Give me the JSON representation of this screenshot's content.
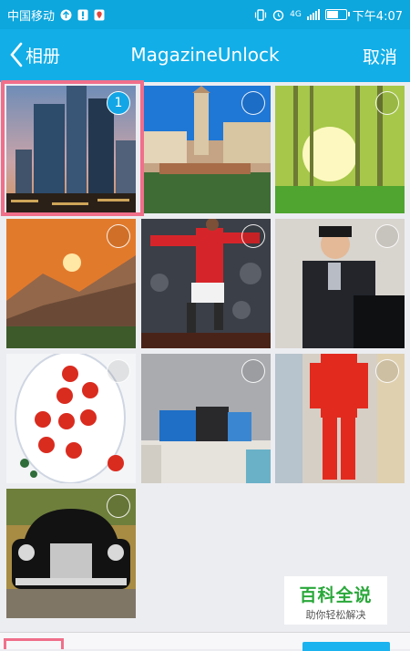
{
  "status_bar": {
    "carrier": "中国移动",
    "network": "4G",
    "time": "下午4:07"
  },
  "title_bar": {
    "back_label": "相册",
    "title": "MagazineUnlock",
    "cancel_label": "取消"
  },
  "photos": [
    {
      "name": "city-skyline",
      "selected": true,
      "order": "1"
    },
    {
      "name": "old-town-tower",
      "selected": false
    },
    {
      "name": "sunny-forest",
      "selected": false
    },
    {
      "name": "mountain-sunset",
      "selected": false
    },
    {
      "name": "soccer-player",
      "selected": false
    },
    {
      "name": "man-at-piano",
      "selected": false
    },
    {
      "name": "tomatoes-plate",
      "selected": false
    },
    {
      "name": "bedroom-cushions",
      "selected": false
    },
    {
      "name": "red-outfit",
      "selected": false
    },
    {
      "name": "vintage-car",
      "selected": false
    }
  ],
  "watermark": {
    "title": "百科全说",
    "subtitle": "助你轻松解决"
  },
  "colors": {
    "status_bar": "#0da6dd",
    "title_bar": "#12aee8",
    "accent": "#13a6e6",
    "highlight": "#f06f8a"
  }
}
